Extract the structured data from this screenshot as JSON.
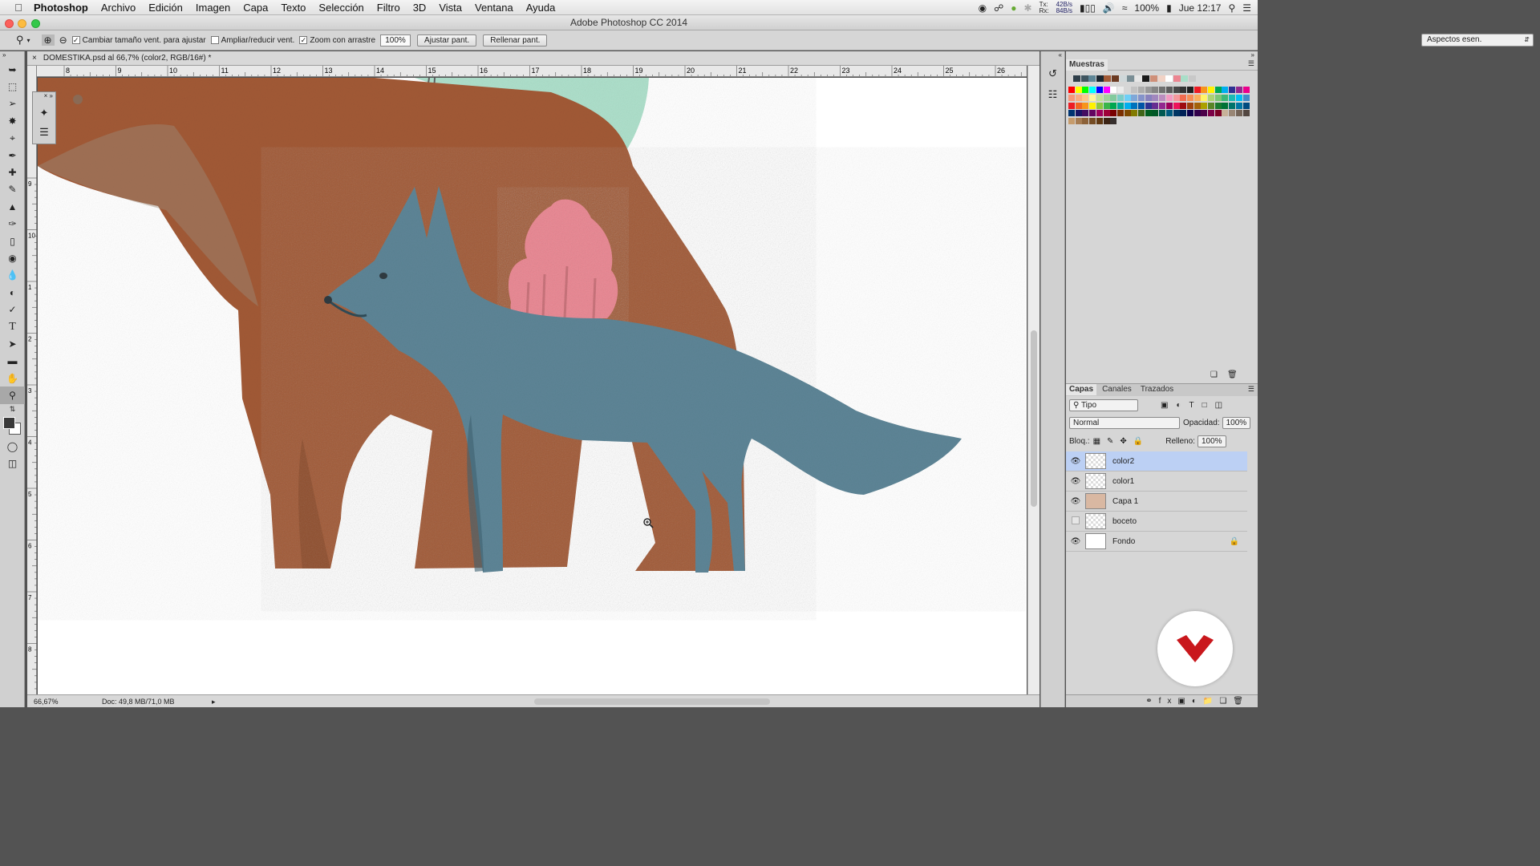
{
  "menubar": {
    "app": "Photoshop",
    "items": [
      "Archivo",
      "Edición",
      "Imagen",
      "Capa",
      "Texto",
      "Selección",
      "Filtro",
      "3D",
      "Vista",
      "Ventana",
      "Ayuda"
    ],
    "net_tx": "42B/s",
    "net_rx": "84B/s",
    "tx_label": "Tx:",
    "rx_label": "Rx:",
    "battery": "100%",
    "clock": "Jue 12:17"
  },
  "window": {
    "title": "Adobe Photoshop CC 2014"
  },
  "options": {
    "resize_label": "Cambiar tamaño vent. para ajustar",
    "resize_checked": true,
    "zoom_all_label": "Ampliar/reducir vent.",
    "zoom_all_checked": false,
    "scrubby_label": "Zoom con arrastre",
    "scrubby_checked": true,
    "zoom_value": "100%",
    "fit_button": "Ajustar pant.",
    "fill_button": "Rellenar pant.",
    "workspace": "Aspectos esen."
  },
  "document": {
    "tab_title": "DOMESTIKA.psd al 66,7% (color2, RGB/16#) *",
    "zoom": "66,67%",
    "doc_size": "Doc: 49,8 MB/71,0 MB",
    "ruler_top": [
      "8",
      "9",
      "10",
      "11",
      "12",
      "13",
      "14",
      "15",
      "16",
      "17",
      "18",
      "19",
      "20",
      "21",
      "22",
      "23",
      "24",
      "25",
      "26"
    ],
    "ruler_left": [
      "9",
      "10",
      "1",
      "2",
      "3",
      "4",
      "5",
      "6",
      "7",
      "8"
    ]
  },
  "panels": {
    "swatches_tab": "Muestras",
    "layers_tabs": [
      "Capas",
      "Canales",
      "Trazados"
    ],
    "filter_kind": "Tipo",
    "blend_mode": "Normal",
    "opacity_label": "Opacidad:",
    "opacity_value": "100%",
    "lock_label": "Bloq.:",
    "fill_label": "Relleno:",
    "fill_value": "100%",
    "layers": [
      {
        "name": "color2",
        "visible": true,
        "selected": true
      },
      {
        "name": "color1",
        "visible": true,
        "selected": false
      },
      {
        "name": "Capa 1",
        "visible": true,
        "selected": false
      },
      {
        "name": "boceto",
        "visible": false,
        "selected": false
      },
      {
        "name": "Fondo",
        "visible": true,
        "selected": false,
        "locked": true
      }
    ]
  },
  "colors": {
    "bear": "#a25a36",
    "wolf": "#5d8596",
    "tree_pink": "#ec8591",
    "tree_mint": "#a9dec8",
    "selection": "#bcd0f4",
    "logo_red": "#c9171c"
  }
}
